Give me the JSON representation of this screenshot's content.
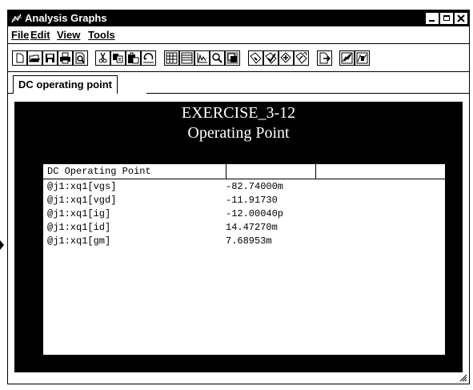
{
  "window": {
    "title": "Analysis Graphs"
  },
  "menu": {
    "file": "File",
    "edit": "Edit",
    "view": "View",
    "tools": "Tools"
  },
  "toolbar_icons": [
    "new-icon",
    "open-icon",
    "save-icon",
    "print-icon",
    "print-preview-icon",
    "cut-icon",
    "copy-icon",
    "paste-icon",
    "undo-icon",
    "grid-icon",
    "table-icon",
    "chart-icon",
    "zoom-icon",
    "overlay-icon",
    "tag-icon",
    "mark-icon",
    "diamond-icon",
    "arrow-tag-icon",
    "export-icon",
    "cursor-icon",
    "cursor-peak-icon"
  ],
  "tab": {
    "label": "DC operating point"
  },
  "plot": {
    "title_line1": "EXERCISE_3-12",
    "title_line2": "Operating Point"
  },
  "table": {
    "header": "DC Operating Point",
    "rows": [
      {
        "name": "@j1:xq1[vgs]",
        "value": "-82.74000m"
      },
      {
        "name": "@j1:xq1[vgd]",
        "value": "-11.91730"
      },
      {
        "name": "@j1:xq1[ig]",
        "value": "-12.00040p"
      },
      {
        "name": "@j1:xq1[id]",
        "value": "14.47270m"
      },
      {
        "name": "@j1:xq1[gm]",
        "value": "7.68953m"
      }
    ]
  }
}
